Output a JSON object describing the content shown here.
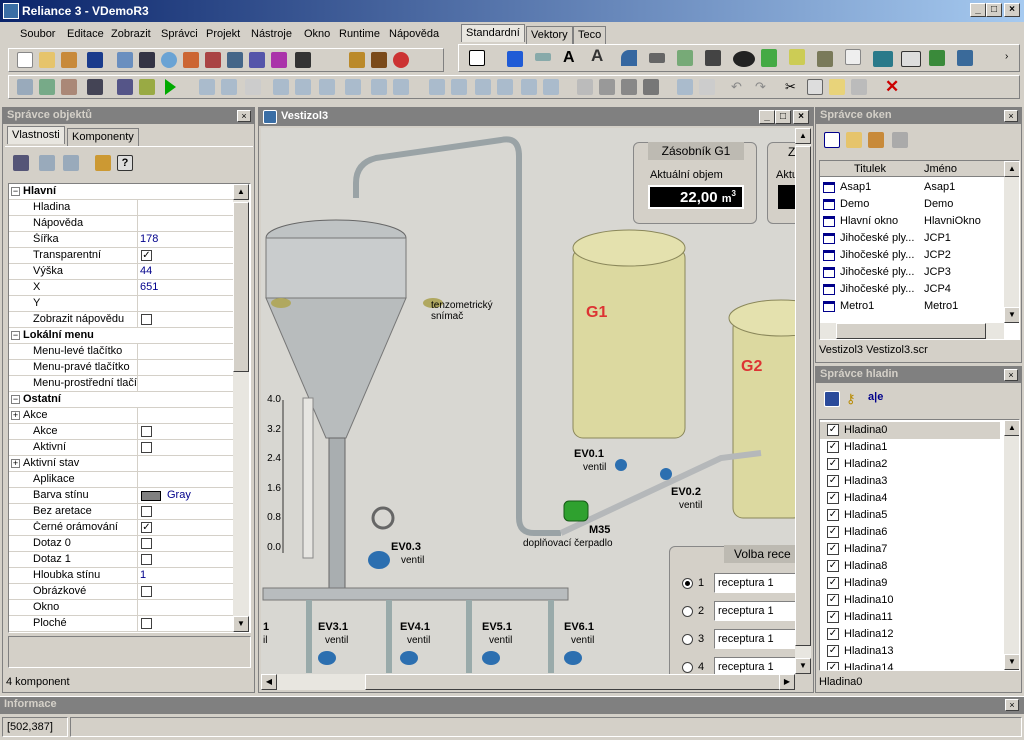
{
  "app": {
    "title": "Reliance 3 - VDemoR3"
  },
  "menu": [
    "Soubor",
    "Editace",
    "Zobrazit",
    "Správci",
    "Projekt",
    "Nástroje",
    "Okno",
    "Runtime",
    "Nápověda"
  ],
  "palette_tabs": [
    "Standardní",
    "Vektory",
    "Teco"
  ],
  "object_manager": {
    "title": "Správce objektů",
    "tabs": [
      "Vlastnosti",
      "Komponenty"
    ],
    "rows": [
      {
        "name": "Hlavní",
        "cat": true
      },
      {
        "name": "Hladina",
        "value": ""
      },
      {
        "name": "Nápověda",
        "value": ""
      },
      {
        "name": "Šířka",
        "value": "178"
      },
      {
        "name": "Transparentní",
        "check": "✓"
      },
      {
        "name": "Výška",
        "value": "44"
      },
      {
        "name": "X",
        "value": "651"
      },
      {
        "name": "Y",
        "value": ""
      },
      {
        "name": "Zobrazit nápovědu",
        "check": ""
      },
      {
        "name": "Lokální menu",
        "cat": true
      },
      {
        "name": "Menu-levé tlačítko",
        "value": ""
      },
      {
        "name": "Menu-pravé tlačítko",
        "value": ""
      },
      {
        "name": "Menu-prostřední tlačít",
        "value": ""
      },
      {
        "name": "Ostatní",
        "cat": true
      },
      {
        "name": "Akce",
        "value": "",
        "plus": true
      },
      {
        "name": "Akce",
        "check": ""
      },
      {
        "name": "Aktivní",
        "check": ""
      },
      {
        "name": "Aktivní stav",
        "value": "",
        "plus": true
      },
      {
        "name": "Aplikace",
        "value": ""
      },
      {
        "name": "Barva stínu",
        "value": "Gray",
        "swatch": "#808080"
      },
      {
        "name": "Bez aretace",
        "check": ""
      },
      {
        "name": "Černé orámování",
        "check": "✓"
      },
      {
        "name": "Dotaz 0",
        "check": ""
      },
      {
        "name": "Dotaz 1",
        "check": ""
      },
      {
        "name": "Hloubka stínu",
        "value": "1"
      },
      {
        "name": "Obrázkové",
        "check": ""
      },
      {
        "name": "Okno",
        "value": ""
      },
      {
        "name": "Ploché",
        "check": ""
      }
    ],
    "status": "4 komponent"
  },
  "editor": {
    "title": "Vestizol3",
    "storage": {
      "title": "Zásobník G1",
      "label": "Aktuální objem",
      "value": "22,00",
      "unit": "m",
      "sup": "3",
      "title2": "Z",
      "label2": "Aktu"
    },
    "tank_labels": [
      "G1",
      "G2"
    ],
    "sensor": "tenzometrický\nsnímač",
    "scale": [
      "4.0",
      "3.2",
      "2.4",
      "1.6",
      "0.8",
      "0.0"
    ],
    "valves": [
      {
        "name": "EV0.1",
        "sub": "ventil"
      },
      {
        "name": "EV0.2",
        "sub": "ventil"
      },
      {
        "name": "EV0.3",
        "sub": "ventil"
      },
      {
        "name": "M35",
        "sub": "doplňovací čerpadlo"
      }
    ],
    "bottom_valves": [
      {
        "name": "1",
        "sub": "il"
      },
      {
        "name": "EV3.1",
        "sub": "ventil"
      },
      {
        "name": "EV4.1",
        "sub": "ventil"
      },
      {
        "name": "EV5.1",
        "sub": "ventil"
      },
      {
        "name": "EV6.1",
        "sub": "ventil"
      }
    ],
    "recipe": {
      "title": "Volba rece",
      "options": [
        {
          "num": "1",
          "label": "receptura 1",
          "checked": true
        },
        {
          "num": "2",
          "label": "receptura 1"
        },
        {
          "num": "3",
          "label": "receptura 1"
        },
        {
          "num": "4",
          "label": "receptura 1"
        }
      ]
    }
  },
  "window_manager": {
    "title": "Správce oken",
    "cols": [
      "Titulek",
      "Jméno"
    ],
    "rows": [
      [
        "Asap1",
        "Asap1"
      ],
      [
        "Demo",
        "Demo"
      ],
      [
        "Hlavní okno",
        "HlavniOkno"
      ],
      [
        "Jihočeské ply...",
        "JCP1"
      ],
      [
        "Jihočeské ply...",
        "JCP2"
      ],
      [
        "Jihočeské ply...",
        "JCP3"
      ],
      [
        "Jihočeské ply...",
        "JCP4"
      ],
      [
        "Metro1",
        "Metro1"
      ]
    ],
    "status": "Vestizol3  Vestizol3.scr"
  },
  "layer_manager": {
    "title": "Správce hladin",
    "layers": [
      "Hladina0",
      "Hladina1",
      "Hladina2",
      "Hladina3",
      "Hladina4",
      "Hladina5",
      "Hladina6",
      "Hladina7",
      "Hladina8",
      "Hladina9",
      "Hladina10",
      "Hladina11",
      "Hladina12",
      "Hladina13",
      "Hladina14"
    ],
    "status": "Hladina0"
  },
  "info": {
    "title": "Informace",
    "coords": "[502,387]"
  }
}
